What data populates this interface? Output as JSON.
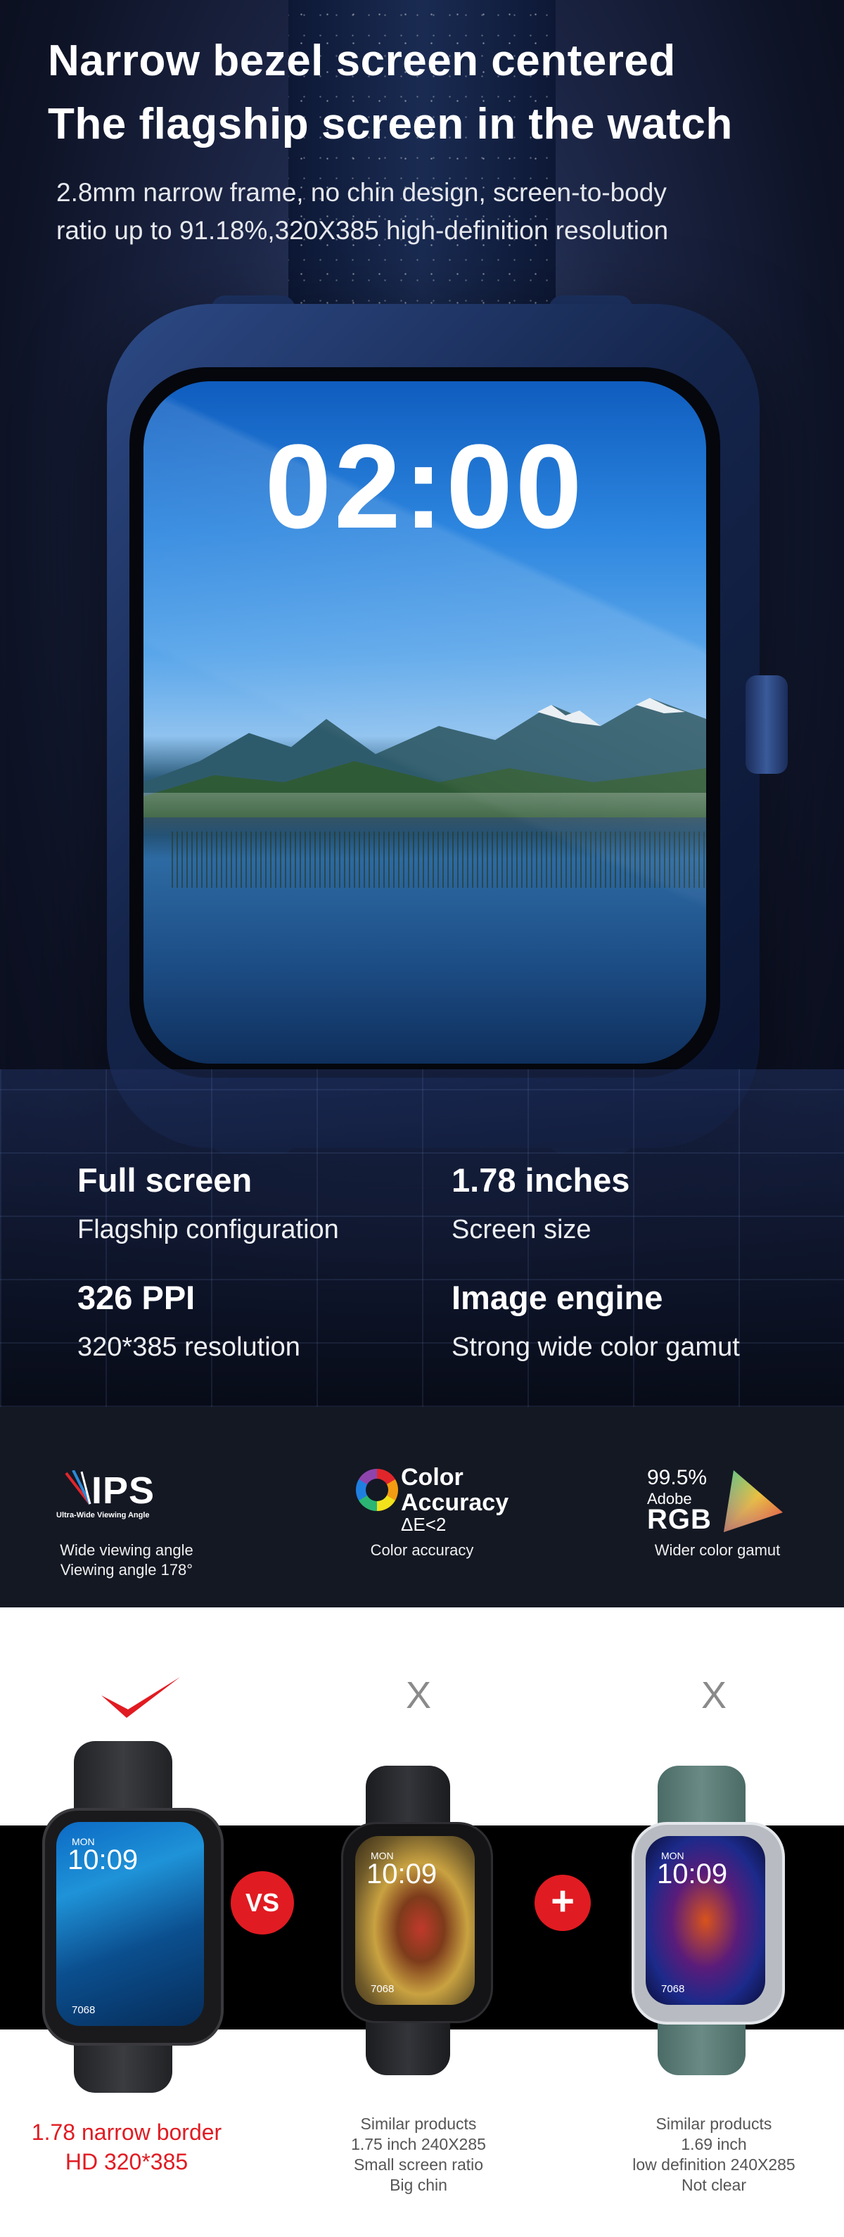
{
  "hero": {
    "title_line1": "Narrow bezel screen centered",
    "title_line2": "The flagship screen in the watch",
    "subtitle_line1": "2.8mm narrow frame, no chin design, screen-to-body",
    "subtitle_line2": "ratio up to 91.18%,320X385 high-definition resolution",
    "watch_time": "02:00"
  },
  "features": [
    {
      "title": "Full screen",
      "desc": "Flagship configuration"
    },
    {
      "title": "1.78 inches",
      "desc": "Screen size"
    },
    {
      "title": "326 PPI",
      "desc": "320*385 resolution"
    },
    {
      "title": "Image engine",
      "desc": "Strong wide color gamut"
    }
  ],
  "specs": {
    "ips": {
      "logo_word": "IPS",
      "logo_sub": "Ultra-Wide Viewing Angle",
      "label_line1": "Wide viewing angle",
      "label_line2": "Viewing angle 178°"
    },
    "color": {
      "logo_line1": "Color",
      "logo_line2": "Accuracy",
      "logo_delta": "ΔE<2",
      "label": "Color accuracy"
    },
    "gamut": {
      "logo_pct": "99.5%",
      "logo_adobe": "Adobe",
      "logo_rgb": "RGB",
      "label": "Wider color gamut"
    }
  },
  "comparison": {
    "mark_x": "X",
    "vs_label": "VS",
    "plus_label": "+",
    "watch_day": "MON",
    "watch_time": "10:09",
    "watch_steps": "7068",
    "ours": {
      "line1": "1.78 narrow border",
      "line2": "HD 320*385"
    },
    "product_b": {
      "line1": "Similar products",
      "line2": "1.75 inch 240X285",
      "line3": "Small screen ratio",
      "line4": "Big chin"
    },
    "product_c": {
      "line1": "Similar products",
      "line2": "1.69 inch",
      "line3": "low definition 240X285",
      "line4": "Not clear"
    }
  },
  "colors": {
    "accent_red": "#e11b22",
    "hero_blue": "#1d2748",
    "spec_bg": "#141823"
  }
}
